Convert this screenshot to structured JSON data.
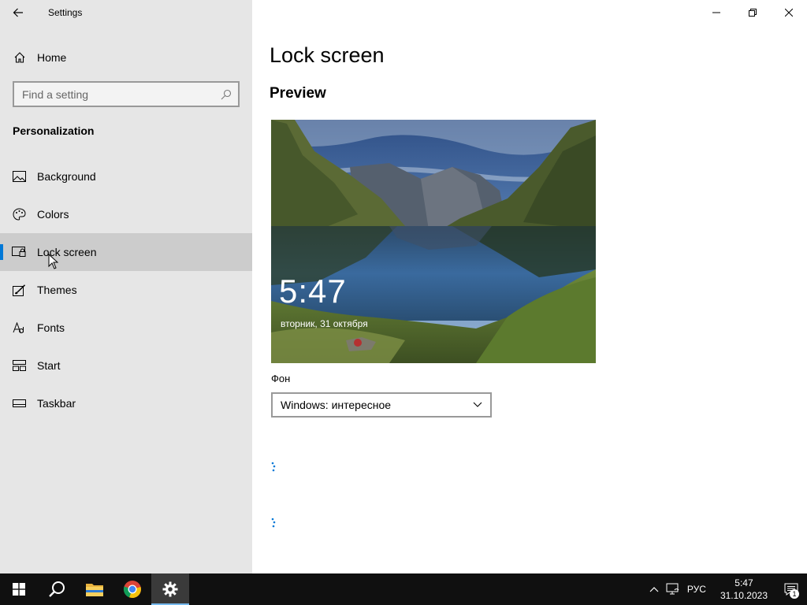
{
  "window": {
    "title": "Settings"
  },
  "sidebar": {
    "home_label": "Home",
    "search_placeholder": "Find a setting",
    "section_label": "Personalization",
    "items": [
      {
        "label": "Background",
        "icon": "image-icon"
      },
      {
        "label": "Colors",
        "icon": "palette-icon"
      },
      {
        "label": "Lock screen",
        "icon": "lock-screen-icon",
        "active": true
      },
      {
        "label": "Themes",
        "icon": "brush-icon"
      },
      {
        "label": "Fonts",
        "icon": "font-icon"
      },
      {
        "label": "Start",
        "icon": "start-layout-icon"
      },
      {
        "label": "Taskbar",
        "icon": "taskbar-icon"
      }
    ]
  },
  "main": {
    "page_title": "Lock screen",
    "preview_heading": "Preview",
    "preview": {
      "time": "5:47",
      "date": "вторник, 31 октября"
    },
    "background_label": "Фон",
    "background_value": "Windows: интересное"
  },
  "taskbar": {
    "apps": [
      {
        "name": "start-button",
        "icon": "windows-logo-icon"
      },
      {
        "name": "search-button",
        "icon": "search-icon"
      },
      {
        "name": "file-explorer-button",
        "icon": "folder-icon"
      },
      {
        "name": "chrome-button",
        "icon": "chrome-icon"
      },
      {
        "name": "settings-button",
        "icon": "gear-icon",
        "active": true
      }
    ],
    "language": "РУС",
    "time": "5:47",
    "date": "31.10.2023",
    "notification_count": "1"
  },
  "colors": {
    "accent": "#0078d7",
    "sidebar_bg": "#e6e6e6",
    "taskbar_bg": "#101010"
  }
}
